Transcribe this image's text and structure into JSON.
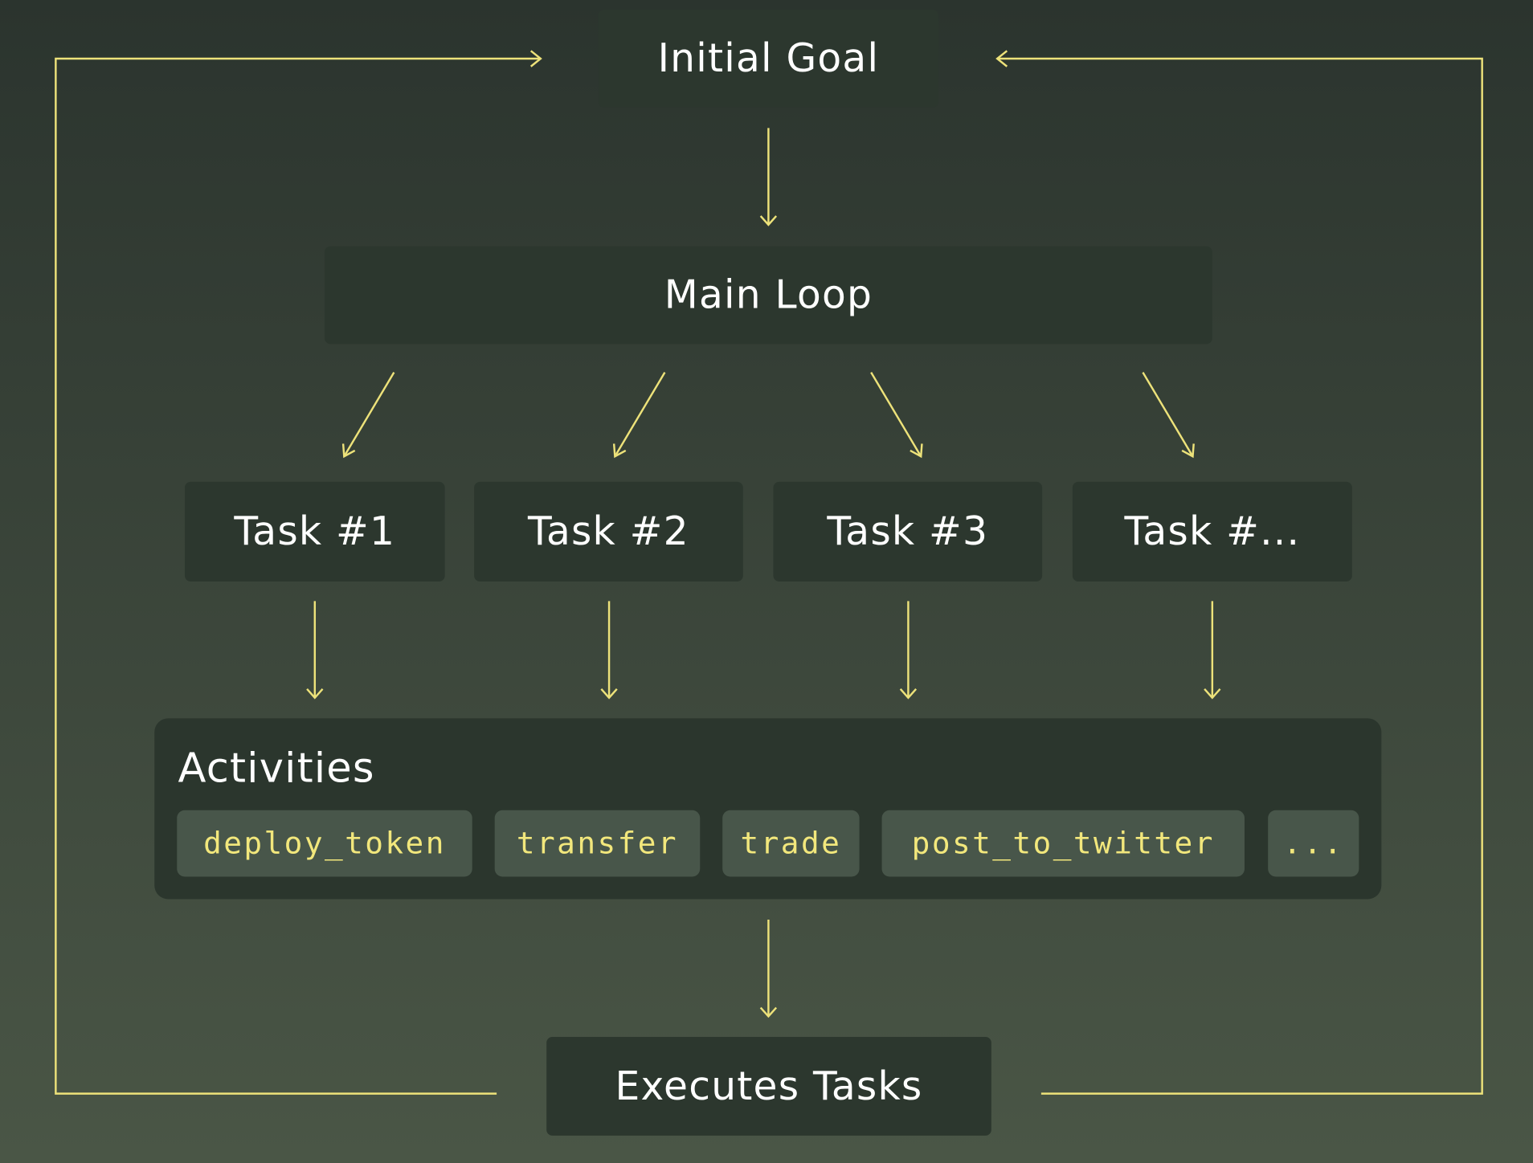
{
  "colors": {
    "arrow": "#ede27a",
    "box": "#2c372e",
    "chip": "#48564a",
    "chip_text": "#f2e77c"
  },
  "nodes": {
    "initial_goal": "Initial Goal",
    "main_loop": "Main Loop",
    "tasks": [
      "Task #1",
      "Task #2",
      "Task #3",
      "Task #..."
    ],
    "activities": {
      "title": "Activities",
      "items": [
        "deploy_token",
        "transfer",
        "trade",
        "post_to_twitter",
        "..."
      ]
    },
    "executes": "Executes Tasks"
  }
}
